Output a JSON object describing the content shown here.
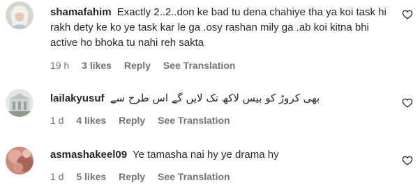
{
  "comments": [
    {
      "username": "shamafahim",
      "text": "Exactly 2..2..don ke bad tu dena chahiye tha ya koi task hi rakh dety ke ko ye task kar le ga .osy rashan mily ga .ab koi kitna bhi active ho bhoka tu nahi reh sakta",
      "time": "19 h",
      "likes": "3 likes",
      "reply_label": "Reply",
      "translation_label": "See Translation"
    },
    {
      "username": "lailakyusuf",
      "text": "بھی کروڑ کو بیس لاکھ تک لایں گے اس طرح سے",
      "time": "1 d",
      "likes": "4 likes",
      "reply_label": "Reply",
      "translation_label": "See Translation"
    },
    {
      "username": "asmashakeel09",
      "text": "Ye tamasha nai hy ye drama hy",
      "time": "1 d",
      "likes": "5 likes",
      "reply_label": "Reply",
      "translation_label": "See Translation"
    }
  ],
  "icons": {
    "like": "heart-outline-icon"
  },
  "colors": {
    "text": "#262626",
    "meta": "#737373"
  }
}
